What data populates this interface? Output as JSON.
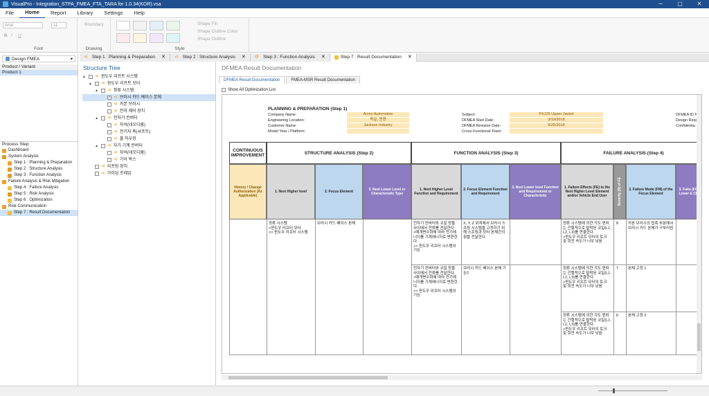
{
  "app": {
    "title": "VisualPro - Integration_STPA_FMEA_FTA_TARA for 1.0.34(KOR).vsa"
  },
  "menu": {
    "items": [
      "File",
      "Home",
      "Report",
      "Library",
      "Settings",
      "Help"
    ],
    "active": "Home"
  },
  "ribbon": {
    "font_label": "Font",
    "font_name": "Arial",
    "font_size": "11",
    "bold": "B",
    "italic": "I",
    "underline": "U",
    "drawing_label": "Drawing",
    "boundary": "Boundary",
    "style_label": "Style",
    "shape_fill": "Shape Fill",
    "shape_outline_color": "Shape Outline Color",
    "shape_outline": "Shape Outline"
  },
  "doc_tabs": [
    {
      "label": "Step 1 : Planning & Preparation"
    },
    {
      "label": "Step 2 : Structure Analysis"
    },
    {
      "label": "Step 3 : Function Analysis"
    },
    {
      "label": "Step 7 : Result Documentation"
    }
  ],
  "sidebar": {
    "dropdown": "Design FMEA",
    "header": "Product / Variant",
    "product": "Product 1",
    "process_step": "Process Step",
    "items": [
      {
        "label": "Dashboard",
        "level": 0
      },
      {
        "label": "System Analysis",
        "level": 0
      },
      {
        "label": "Step 1 : Planning & Preparation",
        "level": 1
      },
      {
        "label": "Step 2 : Structure Analysis",
        "level": 1
      },
      {
        "label": "Step 3 : Function Analysis",
        "level": 1
      },
      {
        "label": "Failure Analysis & Risk Mitigation",
        "level": 0
      },
      {
        "label": "Step 4 : Failure Analysis",
        "level": 1
      },
      {
        "label": "Step 5 : Risk Analysis",
        "level": 1
      },
      {
        "label": "Step 6 : Optimization",
        "level": 1
      },
      {
        "label": "Risk Communication",
        "level": 0
      },
      {
        "label": "Step 7 : Result Documentation",
        "level": 1
      }
    ]
  },
  "structure_tree": {
    "title": "Structure Tree",
    "nodes": [
      {
        "label": "윈도우 리프트 시스템",
        "level": 0,
        "tri": "▲"
      },
      {
        "label": "윈도우 리프트 모터",
        "level": 1,
        "tri": "▲"
      },
      {
        "label": "정류 시스템",
        "level": 2,
        "tri": "▲"
      },
      {
        "label": "브러시 카드 베이스 본체",
        "level": 3,
        "tri": "",
        "checked": true
      },
      {
        "label": "카본 브러시",
        "level": 3,
        "tri": ""
      },
      {
        "label": "전자 제어 장치",
        "level": 3,
        "tri": ""
      },
      {
        "label": "전자기 컨버터",
        "level": 2,
        "tri": "▲"
      },
      {
        "label": "자석(네오디뮴)",
        "level": 3,
        "tri": ""
      },
      {
        "label": "전기자 축(샤프트)",
        "level": 3,
        "tri": ""
      },
      {
        "label": "볼 하우징",
        "level": 3,
        "tri": ""
      },
      {
        "label": "자기 기계 컨버터",
        "level": 2,
        "tri": "▲"
      },
      {
        "label": "자석(네오디뮴)",
        "level": 3,
        "tri": ""
      },
      {
        "label": "기어 박스",
        "level": 3,
        "tri": ""
      },
      {
        "label": "리프팅 장치",
        "level": 1,
        "tri": ""
      },
      {
        "label": "가이딩 프레임",
        "level": 1,
        "tri": ""
      }
    ]
  },
  "main": {
    "title": "DFMEA Result Documentation",
    "tabs": [
      "DFMEA Result Documentation",
      "FMEA-MSR Result Documentation"
    ],
    "show_all": "Show All Optimization List"
  },
  "doc": {
    "planning_title": "PLANNING & PREPARATION (Step 1)",
    "company_label": "Company Name:",
    "company": "Acme Automotive",
    "location_label": "Engineering Location:",
    "location": "독일, 뮌헨",
    "customer_label": "Customer Name:",
    "customer": "Jackson Industry",
    "model_label": "Model Year / Platform:",
    "subject_label": "Subject:",
    "subject": "PX125 Upper Jacket",
    "start_label": "DFMEA Start Date:",
    "start": "3/19/2018",
    "revision_label": "DFMEA Revision Date:",
    "revision": "9/25/2018",
    "team_label": "Cross-Functional Team:",
    "id_label": "DFMEA ID N",
    "resp_label": "Design Resp",
    "conf_label": "Confidentia",
    "continuous": "CONTINUOUS IMPROVEMENT",
    "structure": "STRUCTURE ANALYSIS (Step 2)",
    "function": "FUNCTION ANALYSIS (Step 3)",
    "failure": "FAILURE ANALYSIS (Step 4)",
    "col_history": "History / Change Authorization (As Applicable)",
    "col_s1": "1. Next Higher level",
    "col_s2": "2. Focus Element",
    "col_s3": "3. Next Lower Level or Characteristic Type",
    "col_f1": "1. Next Higher Level Function and Requirement",
    "col_f2": "2. Focus Element Function and Requirement",
    "col_f3": "3. Next Lower level Function and Requirement or Characteristic",
    "col_fe": "1. Failure Effects (FE) to the Next Higher Level Element and/or Vehicle End User",
    "col_sev": "Severity (S) of FE",
    "col_fm": "2. Failure Mode (FM) of the Focus Element",
    "col_fc": "3. Failu (FC) of Lower E Chara",
    "s1": "정류 시스템\n >윈도우 리프터 모터\n >> 윈도우 리프터 시스템",
    "s2": "브러시 카드 베이스 본체",
    "f1a": "전자기 컨버터와 코일 망을 사이에서 전류를 전달한다.\n >매개변수화에 따라 전기에너지를 기계에너지로 변환한다.\n >> 윈도우 리프터 시스템의 기능",
    "f1b": "전자기 컨버터와 코일 망을 사이에서 전류를 전달한다.\n >매개변수화에 따라 전기에너지를 기계에너지로 변환한다.\n >> 윈도우 리프터 시스템의 기능",
    "f2a": "X, Y, Z 위치에서 브러시 스프링 시스템을 고정하기 위해 스프링과 모터 본체간의 힘을 전달한다.",
    "f2b": "브러시 카드 베이스 본체 기능2",
    "fe1": "정류 시스템에 의한 각도 편차는 간헐적으로 탈락된 코일(L1, L2, L3)를 연결한다.\n >윈도우 리프트 모터의 토크 및 회전 속도가 너무 낮음",
    "sev1": "8",
    "fm1": "카본 브러시의 접촉 부분에서 브러시 카드 본체가 구부러짐",
    "fe2": "정류 시스템에 의한 각도 편차는 간헐적으로 탈락된 코일(L1, L2, L3)를 연결한다.\n >윈도우 리프트 모터의 토크 및 회전 속도가 너무 낮음",
    "sev2": "7",
    "fm2": "본체 고정 1",
    "fe3": "정류 시스템에 의한 각도 편차는 간헐적으로 탈락된 코일(L1, L2, L3)를 연결한다.\n >윈도우 리프트 모터의 토크 및 회전 속도가 너무 낮음",
    "sev3": "6",
    "fm3": "본체 고정 2"
  },
  "colors": {
    "titlebar": "#1f4f8f",
    "history": "#fbe7b8",
    "structure": "#d9d9d9",
    "focus": "#bdd7ee",
    "lower": "#8e7cc3",
    "severity": "#999999"
  }
}
